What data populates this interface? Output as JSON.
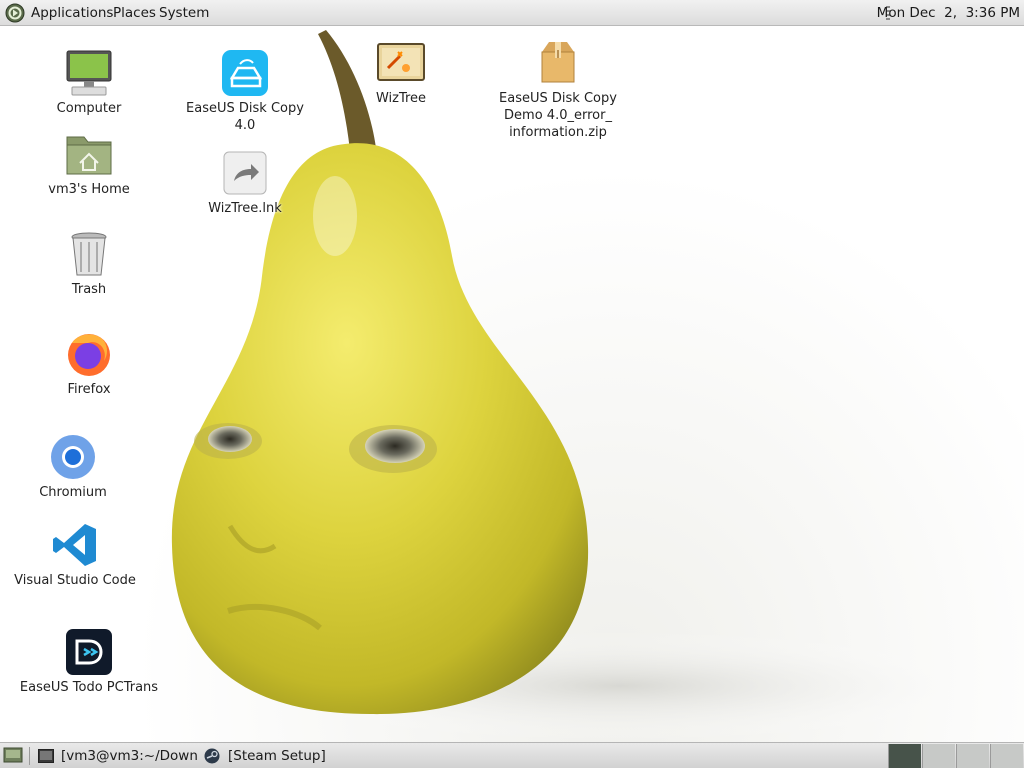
{
  "top_panel": {
    "menus": [
      "Applications",
      "Places",
      "System"
    ],
    "clock": "Mon Dec  2,  3:36 PM"
  },
  "desktop": {
    "icons": [
      {
        "label": "Computer",
        "icon": "computer-icon"
      },
      {
        "label": "vm3's Home",
        "icon": "home-folder-icon"
      },
      {
        "label": "Trash",
        "icon": "trash-icon"
      },
      {
        "label": "Firefox",
        "icon": "firefox-icon"
      },
      {
        "label": "Chromium",
        "icon": "chromium-icon"
      },
      {
        "label": "Visual Studio Code",
        "icon": "vscode-icon"
      },
      {
        "label": "EaseUS Todo PCTrans",
        "icon": "easeus-pctrans-icon"
      },
      {
        "label": "EaseUS Disk Copy 4.0",
        "icon": "easeus-disk-copy-icon"
      },
      {
        "label": "WizTree.lnk",
        "icon": "shortcut-icon"
      },
      {
        "label": "WizTree",
        "icon": "wiztree-icon"
      },
      {
        "label": "EaseUS Disk Copy\nDemo 4.0_error_\ninformation.zip",
        "icon": "zip-archive-icon"
      }
    ]
  },
  "bottom_panel": {
    "tasks": [
      {
        "label": "[vm3@vm3:~/Down…",
        "icon": "terminal-icon"
      },
      {
        "label": "[Steam Setup]",
        "icon": "steam-icon"
      }
    ],
    "workspaces": 4
  },
  "colors": {
    "panel_bg": "#dcdcdc",
    "pear": "#d8cf3a",
    "active_workspace": "#47534a"
  }
}
